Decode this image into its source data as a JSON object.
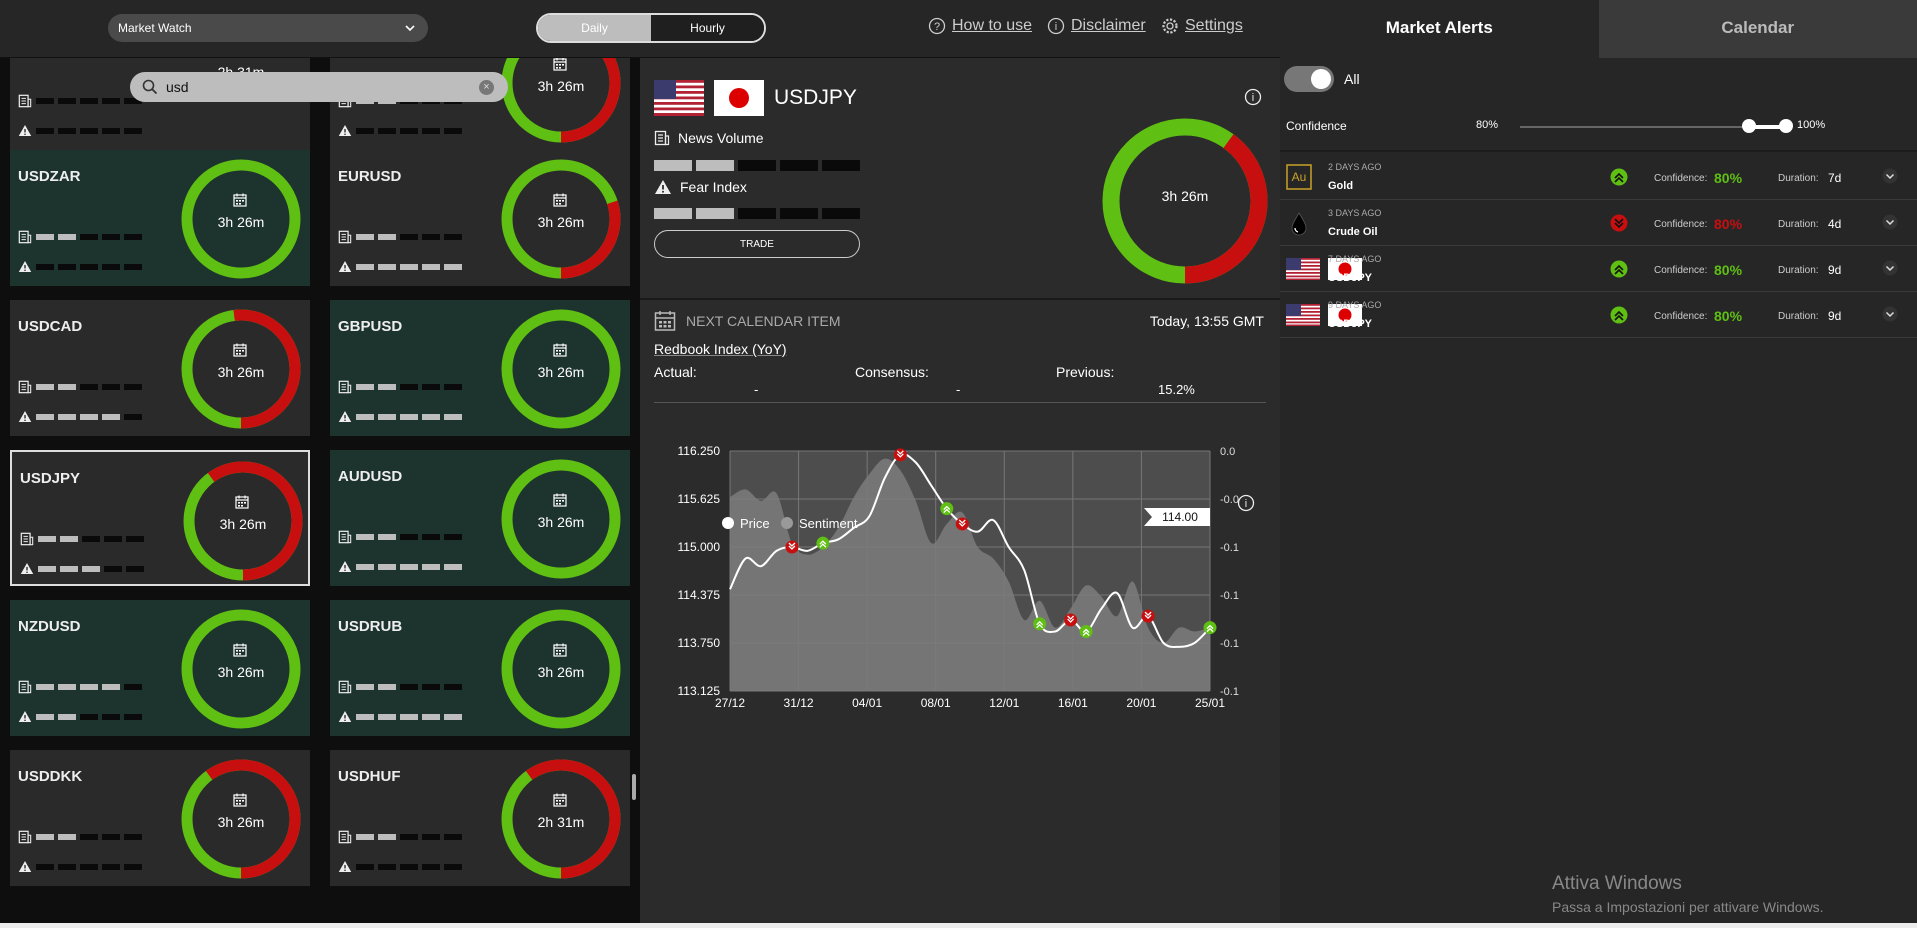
{
  "topbar": {
    "market_select": "Market Watch",
    "period_daily": "Daily",
    "period_hourly": "Hourly",
    "how_to_use": "How to use",
    "disclaimer": "Disclaimer",
    "settings": "Settings"
  },
  "tabs": {
    "alerts": "Market Alerts",
    "calendar": "Calendar"
  },
  "search": {
    "value": "usd"
  },
  "cards": [
    {
      "name": "",
      "duration": "2h 31m",
      "red_fraction": 0,
      "news": 0,
      "fear": 0,
      "partial": true,
      "style": "red"
    },
    {
      "name": "",
      "duration": "3h 26m",
      "red_fraction": 0.6,
      "news": 2,
      "fear": 0,
      "partial": true,
      "style": "red"
    },
    {
      "name": "USDZAR",
      "duration": "3h 26m",
      "red_fraction": 0,
      "news": 2,
      "fear": 0,
      "style": "green"
    },
    {
      "name": "EURUSD",
      "duration": "3h 26m",
      "red_fraction": 0.3,
      "news": 2,
      "fear": 5,
      "style": "red"
    },
    {
      "name": "USDCAD",
      "duration": "3h 26m",
      "red_fraction": 0.52,
      "news": 2,
      "fear": 4,
      "style": "red"
    },
    {
      "name": "GBPUSD",
      "duration": "3h 26m",
      "red_fraction": 0,
      "news": 2,
      "fear": 5,
      "style": "green"
    },
    {
      "name": "USDJPY",
      "duration": "3h 26m",
      "red_fraction": 0.6,
      "news": 2,
      "fear": 3,
      "style": "red",
      "selected": true
    },
    {
      "name": "AUDUSD",
      "duration": "3h 26m",
      "red_fraction": 0,
      "news": 2,
      "fear": 5,
      "style": "green"
    },
    {
      "name": "NZDUSD",
      "duration": "3h 26m",
      "red_fraction": 0,
      "news": 4,
      "fear": 2,
      "style": "green"
    },
    {
      "name": "USDRUB",
      "duration": "3h 26m",
      "red_fraction": 0,
      "news": 2,
      "fear": 5,
      "style": "green"
    },
    {
      "name": "USDDKK",
      "duration": "3h 26m",
      "red_fraction": 0.6,
      "news": 2,
      "fear": 0,
      "style": "red"
    },
    {
      "name": "USDHUF",
      "duration": "2h 31m",
      "red_fraction": 0.6,
      "news": 2,
      "fear": 0,
      "style": "red"
    }
  ],
  "detail": {
    "pair": "USDJPY",
    "news_label": "News Volume",
    "news_level": 2,
    "fear_label": "Fear Index",
    "fear_level": 2,
    "trade": "TRADE",
    "duration": "3h 26m",
    "red_fraction": 0.4
  },
  "calendar": {
    "header": "NEXT CALENDAR ITEM",
    "time": "Today, 13:55 GMT",
    "event": "Redbook Index (YoY)",
    "actual_label": "Actual:",
    "actual": "-",
    "consensus_label": "Consensus:",
    "consensus": "-",
    "previous_label": "Previous:",
    "previous": "15.2%"
  },
  "chart_data": {
    "type": "line",
    "legend": [
      "Price",
      "Sentiment"
    ],
    "current_price_label": "114.00",
    "y_ticks": [
      "116.250",
      "115.625",
      "115.000",
      "114.375",
      "113.750",
      "113.125"
    ],
    "y_right_ticks": [
      "0.0",
      "-0.0",
      "-0.1",
      "-0.1",
      "-0.1",
      "-0.1"
    ],
    "x_ticks": [
      "27/12",
      "31/12",
      "04/01",
      "08/01",
      "12/01",
      "16/01",
      "20/01",
      "25/01"
    ],
    "ylim": [
      113.125,
      116.25
    ],
    "price": [
      114.45,
      114.85,
      114.75,
      114.95,
      115.0,
      114.95,
      115.05,
      115.1,
      115.25,
      115.4,
      115.9,
      116.2,
      116.1,
      115.8,
      115.5,
      115.3,
      115.2,
      115.35,
      115.0,
      114.7,
      114.0,
      113.9,
      114.05,
      113.9,
      114.2,
      114.4,
      113.95,
      114.1,
      113.75,
      113.7,
      113.75,
      113.95
    ],
    "sentiment": [
      115.65,
      115.75,
      115.6,
      115.7,
      115.05,
      114.9,
      115.0,
      115.25,
      115.65,
      115.95,
      116.15,
      116.0,
      115.6,
      115.05,
      115.3,
      115.45,
      115.0,
      114.85,
      114.55,
      114.05,
      114.3,
      113.95,
      114.2,
      114.5,
      114.35,
      114.1,
      114.55,
      113.95,
      113.75,
      113.95,
      113.9,
      113.95
    ],
    "markers": [
      {
        "i": 4,
        "dir": "down"
      },
      {
        "i": 6,
        "dir": "up"
      },
      {
        "i": 11,
        "dir": "down"
      },
      {
        "i": 14,
        "dir": "up"
      },
      {
        "i": 15,
        "dir": "down"
      },
      {
        "i": 20,
        "dir": "up"
      },
      {
        "i": 22,
        "dir": "down"
      },
      {
        "i": 23,
        "dir": "up"
      },
      {
        "i": 27,
        "dir": "down"
      },
      {
        "i": 31,
        "dir": "up"
      }
    ]
  },
  "alerts": {
    "all_label": "All",
    "confidence_label": "Confidence",
    "conf_min": "80%",
    "conf_max": "100%",
    "conf_range": [
      0.8,
      1.0
    ],
    "conf_label": "Confidence:",
    "dur_label": "Duration:",
    "items": [
      {
        "ago": "2 DAYS AGO",
        "name": "Gold",
        "icon": "gold-icon",
        "dir": "up",
        "conf": "80%",
        "dur": "7d"
      },
      {
        "ago": "3 DAYS AGO",
        "name": "Crude Oil",
        "icon": "oil-drop-icon",
        "dir": "down",
        "conf": "80%",
        "dur": "4d"
      },
      {
        "ago": "7 DAYS AGO",
        "name": "USDJPY",
        "icon": "us-jp-flags-icon",
        "dir": "up",
        "conf": "80%",
        "dur": "9d"
      },
      {
        "ago": "9 DAYS AGO",
        "name": "USDJPY",
        "icon": "us-jp-flags-icon",
        "dir": "up",
        "conf": "80%",
        "dur": "9d"
      }
    ]
  },
  "watermark": {
    "line1": "Attiva Windows",
    "line2": "Passa a Impostazioni per attivare Windows."
  },
  "colors": {
    "green": "#5fbf13",
    "red": "#c80f0f",
    "bar_on": "#bdbdbd",
    "bar_off": "#0a0a0a"
  }
}
